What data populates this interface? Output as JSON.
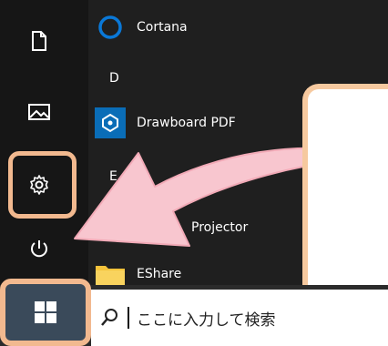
{
  "start_menu": {
    "apps": [
      {
        "label": "Cortana",
        "icon": "cortana-ring-icon"
      },
      {
        "label": "Drawboard PDF",
        "icon": "drawboard-icon"
      },
      {
        "label": "Projector",
        "icon": "projector-icon"
      },
      {
        "label": "EShare",
        "icon": "folder-icon"
      }
    ],
    "letters": [
      "D",
      "E"
    ]
  },
  "rail": {
    "icons": [
      "document-icon",
      "pictures-icon",
      "settings-icon",
      "power-icon"
    ]
  },
  "taskbar": {
    "search_placeholder": "ここに入力して検索",
    "start_icon": "windows-logo-icon"
  },
  "colors": {
    "highlight": "#f2b98f",
    "arrow": "#f8c6cf",
    "accent": "#0078d7"
  }
}
